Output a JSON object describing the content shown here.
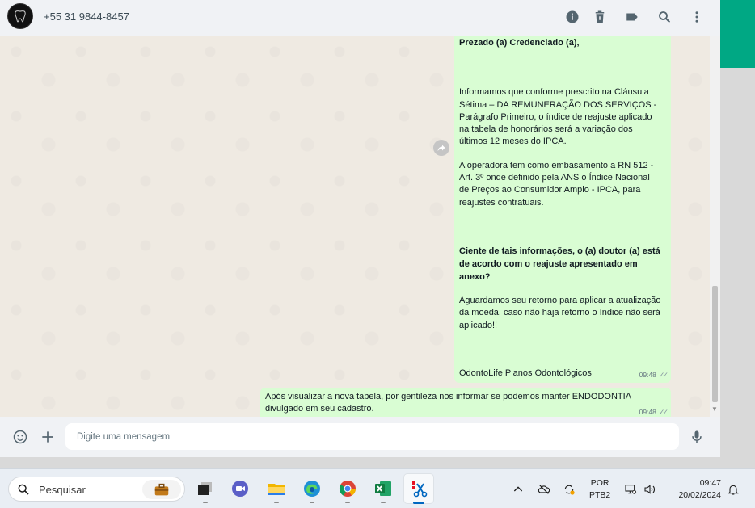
{
  "header": {
    "contact_name": "+55 31 9844-8457",
    "icons": [
      "info-icon",
      "trash-icon",
      "label-icon",
      "search-icon",
      "menu-icon"
    ]
  },
  "messages": [
    {
      "paragraphs": [
        {
          "text": "Prezado (a) Credenciado (a),",
          "bold": true
        },
        {
          "text": "Informamos que conforme prescrito na Cláusula\nSétima – DA REMUNERAÇÃO DOS SERVIÇOS -\nParágrafo Primeiro, o índice de reajuste aplicado\nna tabela de honorários será a variação dos\núltimos 12 meses do IPCA.",
          "bold": false
        },
        {
          "text": "A operadora tem como embasamento a RN 512 -\nArt. 3º onde definido pela ANS o Índice Nacional\nde Preços ao Consumidor Amplo - IPCA, para\nreajustes contratuais.",
          "bold": false
        },
        {
          "text": "Ciente de tais informações, o (a) doutor (a) está\nde acordo com o reajuste apresentado em\nanexo?",
          "bold": true
        },
        {
          "text": "Aguardamos seu retorno para aplicar a atualização\nda moeda, caso não haja retorno o índice não será\naplicado!!",
          "bold": false
        },
        {
          "text": "OdontoLife Planos Odontológicos",
          "bold": false
        }
      ],
      "time": "09:48"
    },
    {
      "text": "Após visualizar a nova tabela, por gentileza nos informar se podemos manter ENDODONTIA\ndivulgado em seu cadastro.",
      "time": "09:48"
    }
  ],
  "composer": {
    "placeholder": "Digite uma mensagem"
  },
  "taskbar": {
    "search_label": "Pesquisar",
    "apps": [
      "task-view-icon",
      "meet-icon",
      "file-explorer-icon",
      "edge-icon",
      "chrome-icon",
      "excel-icon",
      "snipping-tool-icon"
    ],
    "lang_line1": "POR",
    "lang_line2": "PTB2",
    "time": "09:47",
    "date": "20/02/2024"
  },
  "colors": {
    "bubble": "#d9fdd3",
    "accent": "#00a884",
    "chat_bg": "#efeae2"
  }
}
